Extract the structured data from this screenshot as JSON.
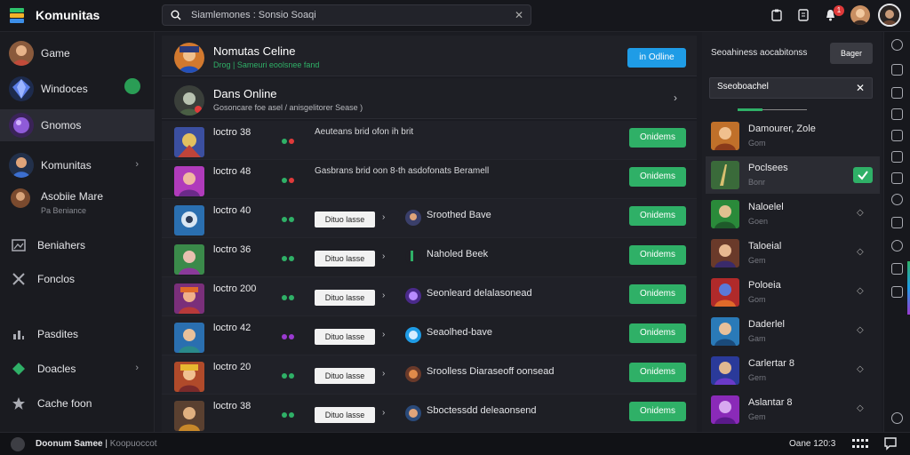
{
  "app": {
    "title": "Komunitas"
  },
  "search": {
    "placeholder": "Siamlemones : Sonsio Soaqi"
  },
  "topbar": {
    "notification_count": "1"
  },
  "sidebar": {
    "items": [
      {
        "label": "Game",
        "icon": "avatar-icon"
      },
      {
        "label": "Windoces",
        "icon": "gem-icon"
      },
      {
        "label": "Gnomos",
        "icon": "sphere-icon"
      },
      {
        "label": "Komunitas",
        "icon": "group-icon",
        "chevron": "›"
      },
      {
        "label": "Asobiie Mare",
        "sub": "Pa Beniance",
        "icon": "avatar-icon"
      },
      {
        "label": "Beniahers",
        "icon": "picture-icon"
      },
      {
        "label": "Fonclos",
        "icon": "tools-icon"
      },
      {
        "label": "Pasdites",
        "icon": "chart-icon"
      },
      {
        "label": "Doacles",
        "icon": "puzzle-icon",
        "chevron": "›"
      },
      {
        "label": "Cache foon",
        "icon": "star-icon"
      }
    ]
  },
  "main": {
    "header_cards": [
      {
        "title": "Nomutas Celine",
        "status": "Drog | Sameuri eoolsnee fand",
        "button": "in Odline"
      },
      {
        "title": "Dans Online",
        "status": "Gosoncare foe asel / anisgelitorer Sease )",
        "chevron": "›"
      }
    ],
    "rows": [
      {
        "name": "loctro 38",
        "desc": "Aeuteans brid   ofon ih brit"
      },
      {
        "name": "loctro 48",
        "desc": "Gasbrans brid  oon   8-th asdofonats Beramell"
      },
      {
        "name": "loctro 40",
        "chip": "Dituo lasse",
        "game": "Sroothed Bave"
      },
      {
        "name": "loctro 36",
        "chip": "Dituo lasse",
        "game": "Naholed Beek"
      },
      {
        "name": "loctro 200",
        "chip": "Dituo lasse",
        "game": "Seonleard delalasonead"
      },
      {
        "name": "loctro 42",
        "chip": "Dituo lasse",
        "game": "Seaolhed-bave"
      },
      {
        "name": "loctro 20",
        "chip": "Dituo lasse",
        "game": "Sroolless Diaraseoff oonsead"
      },
      {
        "name": "loctro 38",
        "chip": "Dituo lasse",
        "game": "Sboctessdd deleaonsend"
      }
    ],
    "row_button": "Onidems"
  },
  "right_panel": {
    "title": "Seoahiness aocabitonss",
    "button": "Bager",
    "search_value": "Sseoboachel",
    "items": [
      {
        "name": "Damourer, Zole",
        "sub": "Gom"
      },
      {
        "name": "Poclsees",
        "sub": "Bonr"
      },
      {
        "name": "Naloelel",
        "sub": "Goen"
      },
      {
        "name": "Taloeial",
        "sub": "Gem"
      },
      {
        "name": "Poloeia",
        "sub": "Gom"
      },
      {
        "name": "Daderlel",
        "sub": "Gam"
      },
      {
        "name": "Carlertar 8",
        "sub": "Gern"
      },
      {
        "name": "Aslantar 8",
        "sub": "Gem"
      }
    ]
  },
  "statusbar": {
    "left_title": "Doonum Samee",
    "left_sub": "Koopuoccot",
    "right": "Oane 120:3"
  },
  "colors": {
    "accent_blue": "#1f9ce6",
    "accent_green": "#2fb067",
    "bg": "#1b1c22"
  }
}
